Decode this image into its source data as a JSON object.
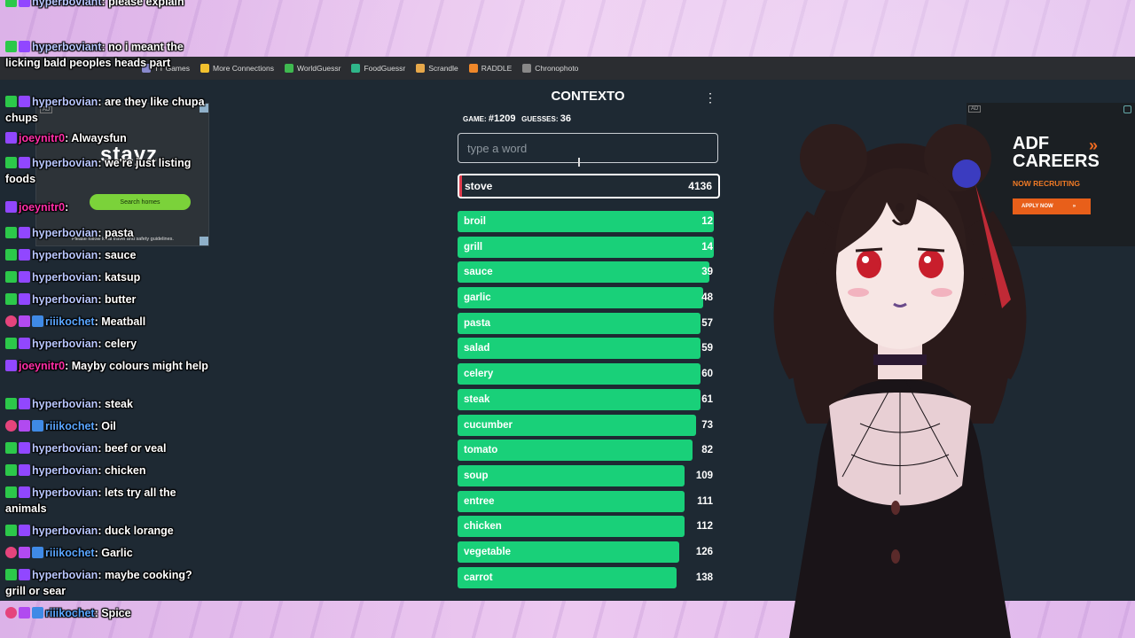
{
  "bookmarks": [
    {
      "label": "TT Games",
      "icon_color": "#8888cc"
    },
    {
      "label": "More Connections",
      "icon_color": "#f2c12e"
    },
    {
      "label": "WorldGuessr",
      "icon_color": "#3fb950"
    },
    {
      "label": "FoodGuessr",
      "icon_color": "#2fb68a"
    },
    {
      "label": "Scrandle",
      "icon_color": "#e7a84a"
    },
    {
      "label": "RADDLE",
      "icon_color": "#f0882a"
    },
    {
      "label": "Chronophoto",
      "icon_color": "#888888"
    }
  ],
  "ads": {
    "left": {
      "tag": "AD",
      "logo": "stayz",
      "button": "Search homes",
      "note": "Please follow local travel and safety guidelines."
    },
    "right": {
      "tag": "AD",
      "title_line1": "ADF",
      "title_line2": "CAREERS",
      "subtitle": "NOW RECRUITING",
      "button": "APPLY NOW"
    }
  },
  "contexto": {
    "title": "CONTEXTO",
    "game_label": "GAME:",
    "game_number": "#1209",
    "guesses_label": "GUESSES:",
    "guesses_count": "36",
    "input_placeholder": "type a word",
    "last_guess": {
      "word": "stove",
      "distance": "4136"
    },
    "guesses": [
      {
        "word": "broil",
        "distance": "12",
        "fill": 0.975
      },
      {
        "word": "grill",
        "distance": "14",
        "fill": 0.975
      },
      {
        "word": "sauce",
        "distance": "39",
        "fill": 0.96
      },
      {
        "word": "garlic",
        "distance": "48",
        "fill": 0.935
      },
      {
        "word": "pasta",
        "distance": "57",
        "fill": 0.925
      },
      {
        "word": "salad",
        "distance": "59",
        "fill": 0.925
      },
      {
        "word": "celery",
        "distance": "60",
        "fill": 0.925
      },
      {
        "word": "steak",
        "distance": "61",
        "fill": 0.925
      },
      {
        "word": "cucumber",
        "distance": "73",
        "fill": 0.91
      },
      {
        "word": "tomato",
        "distance": "82",
        "fill": 0.895
      },
      {
        "word": "soup",
        "distance": "109",
        "fill": 0.865
      },
      {
        "word": "entree",
        "distance": "111",
        "fill": 0.865
      },
      {
        "word": "chicken",
        "distance": "112",
        "fill": 0.865
      },
      {
        "word": "vegetable",
        "distance": "126",
        "fill": 0.845
      },
      {
        "word": "carrot",
        "distance": "138",
        "fill": 0.835
      }
    ],
    "colors": {
      "green": "#19d079",
      "bg": "#1e2933"
    }
  },
  "chat": [
    {
      "user": "hyperboviant",
      "text": "please explain",
      "badges": [
        "green",
        "purple"
      ],
      "ucls": "u-hyper"
    },
    {
      "user": "hyperboviant",
      "text": "no i meant the licking bald peoples heads part",
      "badges": [
        "green",
        "purple"
      ],
      "ucls": "u-hyper"
    },
    {
      "user": "hyperbovian",
      "text": "are they like chupa chups",
      "badges": [
        "green",
        "purple"
      ],
      "ucls": "u-hyper"
    },
    {
      "user": "joeynitr0",
      "text": "Alwaysfun",
      "badges": [
        "purple"
      ],
      "ucls": "u-joey"
    },
    {
      "user": "hyperbovian",
      "text": "we're just listing foods",
      "badges": [
        "green",
        "purple"
      ],
      "ucls": "u-hyper"
    },
    {
      "user": "joeynitr0",
      "text": "",
      "badges": [
        "purple"
      ],
      "ucls": "u-joey"
    },
    {
      "user": "hyperbovian",
      "text": "pasta",
      "badges": [
        "green",
        "purple"
      ],
      "ucls": "u-hyper"
    },
    {
      "user": "hyperbovian",
      "text": "sauce",
      "badges": [
        "green",
        "purple"
      ],
      "ucls": "u-hyper"
    },
    {
      "user": "hyperbovian",
      "text": "katsup",
      "badges": [
        "green",
        "purple"
      ],
      "ucls": "u-hyper"
    },
    {
      "user": "hyperbovian",
      "text": "butter",
      "badges": [
        "green",
        "purple"
      ],
      "ucls": "u-hyper"
    },
    {
      "user": "riiikochet",
      "text": "Meatball",
      "badges": [
        "pink",
        "star",
        "blue"
      ],
      "ucls": "u-riii"
    },
    {
      "user": "hyperbovian",
      "text": "celery",
      "badges": [
        "green",
        "purple"
      ],
      "ucls": "u-hyper"
    },
    {
      "user": "joeynitr0",
      "text": "Mayby colours might help",
      "badges": [
        "purple"
      ],
      "ucls": "u-joey"
    },
    {
      "user": "hyperbovian",
      "text": "steak",
      "badges": [
        "green",
        "purple"
      ],
      "ucls": "u-hyper"
    },
    {
      "user": "riiikochet",
      "text": "Oil",
      "badges": [
        "pink",
        "star",
        "blue"
      ],
      "ucls": "u-riii"
    },
    {
      "user": "hyperbovian",
      "text": "beef or veal",
      "badges": [
        "green",
        "purple"
      ],
      "ucls": "u-hyper"
    },
    {
      "user": "hyperbovian",
      "text": "chicken",
      "badges": [
        "green",
        "purple"
      ],
      "ucls": "u-hyper"
    },
    {
      "user": "hyperbovian",
      "text": "lets try all the animals",
      "badges": [
        "green",
        "purple"
      ],
      "ucls": "u-hyper"
    },
    {
      "user": "hyperbovian",
      "text": "duck lorange",
      "badges": [
        "green",
        "purple"
      ],
      "ucls": "u-hyper"
    },
    {
      "user": "riiikochet",
      "text": "Garlic",
      "badges": [
        "pink",
        "star",
        "blue"
      ],
      "ucls": "u-riii"
    },
    {
      "user": "hyperbovian",
      "text": "maybe cooking? grill or sear",
      "badges": [
        "green",
        "purple"
      ],
      "ucls": "u-hyper"
    },
    {
      "user": "riiikochet",
      "text": "Spice",
      "badges": [
        "pink",
        "star",
        "blue"
      ],
      "ucls": "u-riii"
    }
  ]
}
